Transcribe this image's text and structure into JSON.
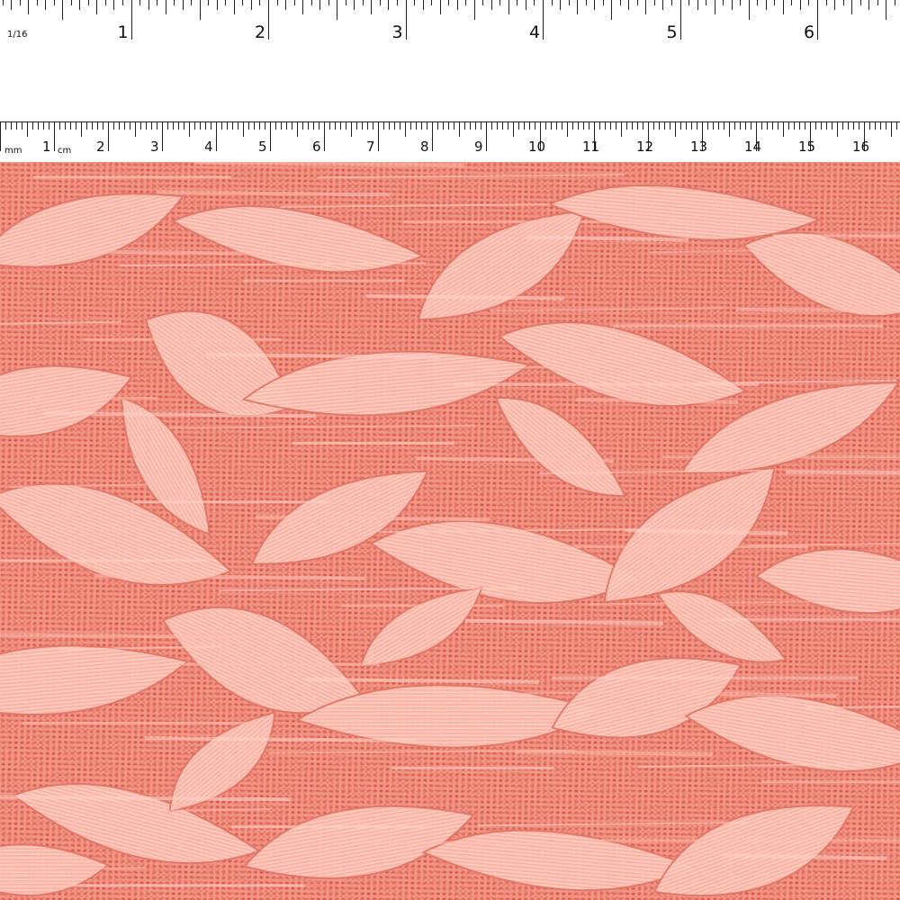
{
  "inch_ruler": {
    "unit_label": "1/16",
    "numbers": [
      "1",
      "2",
      "3",
      "4",
      "5",
      "6"
    ]
  },
  "cm_ruler": {
    "mm_label": "mm",
    "cm_label": "cm",
    "numbers": [
      "1",
      "2",
      "3",
      "4",
      "5",
      "6",
      "7",
      "8",
      "9",
      "10",
      "11",
      "12",
      "13",
      "14",
      "15",
      "16"
    ]
  },
  "fabric": {
    "description_colors": {
      "base": "#f29a8a",
      "mesh_dark": "#d8584a",
      "motif": "#ffc4b8",
      "highlight": "#ffd6cc"
    }
  }
}
